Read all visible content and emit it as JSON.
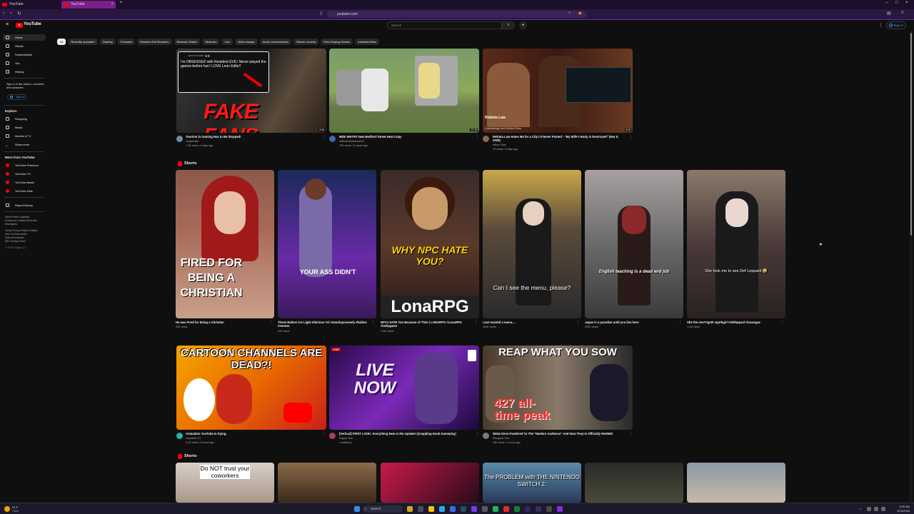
{
  "browser": {
    "tabs": [
      {
        "label": "YouTube"
      },
      {
        "label": "YouTube"
      }
    ],
    "url": "youtube.com"
  },
  "masthead": {
    "logo_text": "YouTube",
    "search_placeholder": "Search",
    "signin_label": "Sign in"
  },
  "chips": [
    "All",
    "Recently uploaded",
    "Gaming",
    "Podcasts",
    "Resident Evil Requiem",
    "Nintendo Switch",
    "Nintendo",
    "Live",
    "Video essays",
    "Audio commentaries",
    "Sketch comedy",
    "Role-Playing Games",
    "Animated films"
  ],
  "sidebar": {
    "items": [
      {
        "label": "Home",
        "icon": "home-icon"
      },
      {
        "label": "Shorts",
        "icon": "shorts-icon"
      },
      {
        "label": "Subscriptions",
        "icon": "subscriptions-icon"
      },
      {
        "label": "You",
        "icon": "you-icon"
      },
      {
        "label": "History",
        "icon": "history-icon"
      }
    ],
    "signin_prompt": "Sign in to like videos, comment, and subscribe.",
    "signin_button": "Sign in",
    "explore_title": "Explore",
    "explore_items": [
      {
        "label": "Shopping"
      },
      {
        "label": "Music"
      },
      {
        "label": "Movies & TV"
      },
      {
        "label": "Show more"
      }
    ],
    "more_title": "More from YouTube",
    "more_items": [
      {
        "label": "YouTube Premium"
      },
      {
        "label": "YouTube TV"
      },
      {
        "label": "YouTube Music"
      },
      {
        "label": "YouTube Kids"
      }
    ],
    "report_history": "Report history",
    "footer_line1": "About  Press  Copyright",
    "footer_line2": "Contact us  Creators  Advertise",
    "footer_line3": "Developers",
    "footer_line4": "Terms  Privacy  Policy & Safety",
    "footer_line5": "How YouTube works",
    "footer_line6": "Test new features",
    "footer_line7": "NFL Sunday Ticket",
    "copyright": "© 2026 Google LLC"
  },
  "row1": [
    {
      "title": "Tourism in Gaming Has to Be Stopped!",
      "channel": "VorgsEditor",
      "meta": "7.4K views • 4 days ago",
      "caption": "FAKE FANS",
      "duration": "8:36",
      "tweet": "I'm OBSESSED with Resident EVIL! Never played the games before but I LOVE Leon Edits!!"
    },
    {
      "title": "MDE WHYPZ  New Bedford Street Heat   Copy",
      "channel": "Millionbollarbotman42",
      "meta": "79K views • 11 years ago",
      "caption": "",
      "duration": "12:16",
      "tweet": ""
    },
    {
      "title": "Rekieta Law Hates Me for a Clip I'd Never Posted - \"My Wife's Body is Destroyed\" (Mar 9, 2026)",
      "channel": "eBore Clips",
      "meta": "2K views • 8 days ago",
      "caption": "Rekieta Law",
      "duration": "8:25",
      "tweet": "Cosmetology, and Chicken Shop"
    }
  ],
  "shorts1_title": "Shorts",
  "shorts1": [
    {
      "title": "He was Fired for being a Christian",
      "meta": "20K views",
      "caption": "FIRED FOR BEING A CHRISTIAN"
    },
    {
      "title": "These Babies Are Light Hilarious #sl #standupcomedy #babies #memes",
      "meta": "12K views",
      "caption": "YOUR ASS DIDN'T"
    },
    {
      "title": "NPCs HATE You Because of This! | LONARPG #LonaRPG #indiegame",
      "meta": "724K views",
      "caption": "WHY NPC HATE YOU?"
    },
    {
      "title": "I just wanted a menu....",
      "meta": "434K views",
      "caption": "Can I see the menu, please?"
    },
    {
      "title": "Japan is a paradise until you live here",
      "meta": "491K views",
      "caption": "English teaching is a dead end job"
    },
    {
      "title": "She the one?#goth #gothgirl #defleppard #lasvegas",
      "meta": "1.1M views",
      "caption": "She took me to see Def Leppard 😂"
    }
  ],
  "row2": [
    {
      "title": "Animation YouTube Is Dying.",
      "channel": "Clownfish TV",
      "meta": "9.2K views • 8 hours ago",
      "caption": "CARTOON CHANNELS ARE DEAD?!",
      "badge": ""
    },
    {
      "title": "[Vertical] FIRST LOOK: Everything New in the Update! (Grappling Hook Gameplay)",
      "channel": "Dapper Dub",
      "meta": "4 watching",
      "caption": "LIVE NOW",
      "badge": "LIVE"
    },
    {
      "title": "Woke Devs Pandered To The \"Modern Audience\" And Now They're Officially RUINED",
      "channel": "Recapper Geo",
      "meta": "46K views • 9 hours ago",
      "caption": "REAP WHAT YOU SOW",
      "badge": "427 all-time peak"
    }
  ],
  "shorts2_title": "Shorts",
  "shorts2": [
    {
      "caption": "Do NOT trust your coworkers"
    },
    {
      "caption": ""
    },
    {
      "caption": ""
    },
    {
      "caption": "The PROBLEM with THE NINTENDO SWITCH 2:"
    },
    {
      "caption": ""
    },
    {
      "caption": ""
    }
  ],
  "taskbar": {
    "weather_temp": "51°F",
    "weather_desc": "Clear",
    "search_label": "Search",
    "time": "2:00 AM",
    "date": "3/13/2026"
  },
  "colors": {
    "brand": "#ff0000",
    "background": "#0f0f0f",
    "link": "#3ea6ff"
  }
}
